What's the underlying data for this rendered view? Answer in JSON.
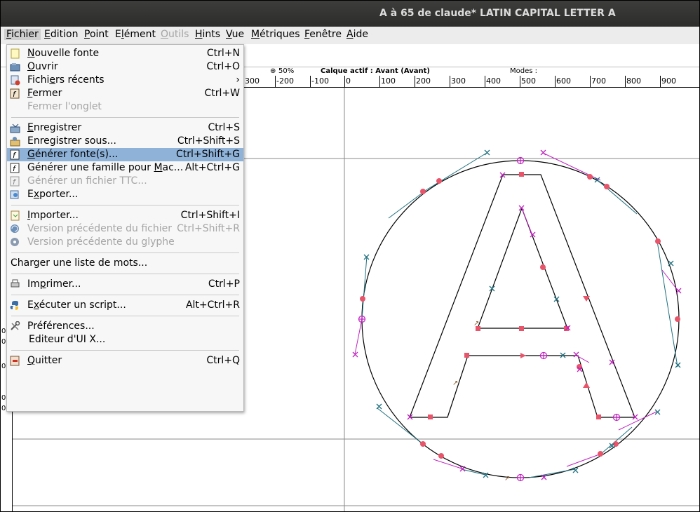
{
  "window": {
    "title": "A à 65 de claude* LATIN CAPITAL LETTER A"
  },
  "menubar": {
    "items": [
      {
        "label": "Fichier",
        "mnemonic": "F",
        "rest": "ichier"
      },
      {
        "label": "Edition",
        "mnemonic": "E",
        "rest": "dition"
      },
      {
        "label": "Point",
        "mnemonic": "P",
        "rest": "oint"
      },
      {
        "label": "Elément",
        "mnemonic": "l",
        "pre": "E",
        "rest": "ément"
      },
      {
        "label": "Outils",
        "mnemonic": "O",
        "rest": "utils"
      },
      {
        "label": "Hints",
        "mnemonic": "H",
        "rest": "ints"
      },
      {
        "label": "Vue",
        "mnemonic": "V",
        "rest": "ue"
      },
      {
        "label": "Métriques",
        "mnemonic": "M",
        "rest": "étriques"
      },
      {
        "label": "Fenêtre",
        "mnemonic": "F",
        "rest": "enêtre"
      },
      {
        "label": "Aide",
        "mnemonic": "A",
        "rest": "ide"
      }
    ]
  },
  "infobar": {
    "zoom": "50%",
    "layer": "Calque actif : Avant (Avant)",
    "modes": "Modes :"
  },
  "ruler": {
    "top_labels": [
      "300",
      "-200",
      "-100",
      "0",
      "100",
      "200",
      "300",
      "400",
      "500",
      "600",
      "700",
      "800",
      "900"
    ],
    "left_labels": [
      "0",
      "0",
      "0",
      "0",
      "0"
    ]
  },
  "file_menu": {
    "items": [
      {
        "kind": "item",
        "pre": "",
        "mn": "N",
        "post": "ouvelle fonte",
        "accel": "Ctrl+N",
        "icon": "new-font-icon",
        "disabled": false
      },
      {
        "kind": "item",
        "pre": "",
        "mn": "O",
        "post": "uvrir",
        "accel": "Ctrl+O",
        "icon": "open-icon",
        "disabled": false
      },
      {
        "kind": "item",
        "pre": "Fichi",
        "mn": "e",
        "post": "rs récents",
        "accel": "›",
        "icon": "recent-files-icon",
        "disabled": false
      },
      {
        "kind": "item",
        "pre": "",
        "mn": "F",
        "post": "ermer",
        "accel": "Ctrl+W",
        "icon": "close-font-icon",
        "disabled": false
      },
      {
        "kind": "item",
        "pre": "Fermer l'onglet",
        "mn": "",
        "post": "",
        "accel": "",
        "icon": "",
        "disabled": true
      },
      {
        "kind": "sep"
      },
      {
        "kind": "item",
        "pre": "",
        "mn": "E",
        "post": "nregistrer",
        "accel": "Ctrl+S",
        "icon": "save-icon",
        "disabled": false
      },
      {
        "kind": "item",
        "pre": "Enregistrer sous...",
        "mn": "",
        "post": "",
        "accel": "Ctrl+Shift+S",
        "icon": "save-as-icon",
        "disabled": false
      },
      {
        "kind": "item",
        "pre": "",
        "mn": "G",
        "post": "énérer fonte(s)...",
        "accel": "Ctrl+Shift+G",
        "icon": "generate-fonts-icon",
        "disabled": false,
        "highlight": true
      },
      {
        "kind": "item",
        "pre": "Générer une famille pour ",
        "mn": "M",
        "post": "ac...",
        "accel": "Alt+Ctrl+G",
        "icon": "generate-family-icon",
        "disabled": false
      },
      {
        "kind": "item",
        "pre": "Générer un fichier TTC...",
        "mn": "",
        "post": "",
        "accel": "",
        "icon": "generate-ttc-icon",
        "disabled": true
      },
      {
        "kind": "item",
        "pre": "E",
        "mn": "x",
        "post": "porter...",
        "accel": "",
        "icon": "export-icon",
        "disabled": false
      },
      {
        "kind": "sep"
      },
      {
        "kind": "item",
        "pre": "",
        "mn": "I",
        "post": "mporter...",
        "accel": "Ctrl+Shift+I",
        "icon": "import-icon",
        "disabled": false
      },
      {
        "kind": "item",
        "pre": "Version précédente du fichier",
        "mn": "",
        "post": "",
        "accel": "Ctrl+Shift+R",
        "icon": "revert-file-icon",
        "disabled": true
      },
      {
        "kind": "item",
        "pre": "Version précédente du glyphe",
        "mn": "",
        "post": "",
        "accel": "",
        "icon": "revert-glyph-icon",
        "disabled": true
      },
      {
        "kind": "sep"
      },
      {
        "kind": "item",
        "pre": "Charger une liste de mots...",
        "mn": "",
        "post": "",
        "accel": "",
        "icon": "",
        "disabled": false,
        "noindent": true
      },
      {
        "kind": "sep"
      },
      {
        "kind": "item",
        "pre": "Im",
        "mn": "p",
        "post": "rimer...",
        "accel": "Ctrl+P",
        "icon": "print-icon",
        "disabled": false
      },
      {
        "kind": "sep"
      },
      {
        "kind": "item",
        "pre": "E",
        "mn": "x",
        "post": "écuter un script...",
        "accel": "Alt+Ctrl+R",
        "icon": "python-icon",
        "disabled": false
      },
      {
        "kind": "sep"
      },
      {
        "kind": "item",
        "pre": "Préférences...",
        "mn": "",
        "post": "",
        "accel": "",
        "icon": "preferences-icon",
        "disabled": false
      },
      {
        "kind": "item",
        "pre": "Editeur d'UI X...",
        "mn": "",
        "post": "",
        "accel": "",
        "icon": "",
        "disabled": false,
        "indent2": true
      },
      {
        "kind": "sep"
      },
      {
        "kind": "item",
        "pre": "",
        "mn": "Q",
        "post": "uitter",
        "accel": "Ctrl+Q",
        "icon": "quit-icon",
        "disabled": false
      }
    ]
  },
  "colors": {
    "highlight": "#8fb2d9",
    "point_red": "#e8556b",
    "handle_teal": "#1f6f7f",
    "handle_magenta": "#c020c0",
    "outline": "#000000"
  }
}
